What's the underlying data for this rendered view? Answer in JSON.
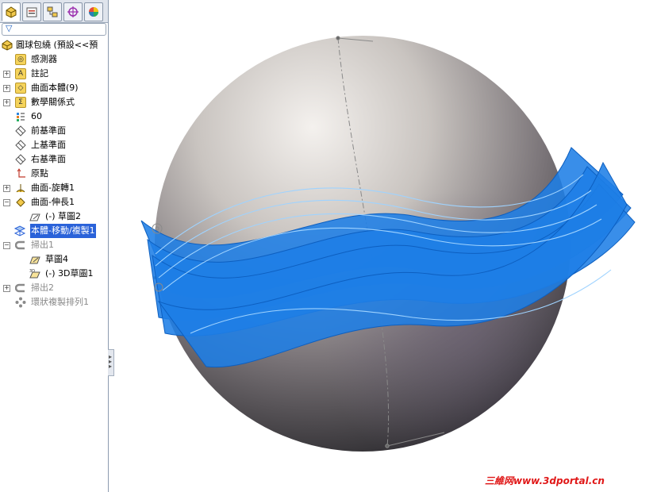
{
  "panel": {
    "tabs": [
      {
        "icon": "feature-manager-icon"
      },
      {
        "icon": "property-manager-icon"
      },
      {
        "icon": "configuration-manager-icon"
      },
      {
        "icon": "dimxpert-icon"
      },
      {
        "icon": "display-manager-icon"
      }
    ],
    "filter_icon": "filter-icon",
    "tree": [
      {
        "label": "圓球包繞 (預設<<預",
        "icon": "part-icon"
      },
      {
        "label": "感測器",
        "icon": "sensor-folder-icon"
      },
      {
        "label": "註記",
        "icon": "annotations-folder-icon"
      },
      {
        "label": "曲面本體(9)",
        "icon": "surface-bodies-folder-icon"
      },
      {
        "label": "數學關係式",
        "icon": "equations-folder-icon"
      },
      {
        "label": "60",
        "icon": "material-icon"
      },
      {
        "label": "前基準面",
        "icon": "plane-icon"
      },
      {
        "label": "上基準面",
        "icon": "plane-icon"
      },
      {
        "label": "右基準面",
        "icon": "plane-icon"
      },
      {
        "label": "原點",
        "icon": "origin-icon"
      },
      {
        "label": "曲面-旋轉1",
        "icon": "revolve-surface-icon"
      },
      {
        "label": "曲面-伸長1",
        "icon": "extrude-surface-icon"
      },
      {
        "label": "(-) 草圖2",
        "icon": "sketch-icon"
      },
      {
        "label": "本體-移動/複製1",
        "icon": "move-copy-body-icon"
      },
      {
        "label": "掃出1",
        "icon": "sweep-icon"
      },
      {
        "label": "草圖4",
        "icon": "sketch-icon"
      },
      {
        "label": "(-) 3D草圖1",
        "icon": "3d-sketch-icon"
      },
      {
        "label": "掃出2",
        "icon": "sweep-icon"
      },
      {
        "label": "環狀複製排列1",
        "icon": "circular-pattern-icon"
      }
    ]
  },
  "colors": {
    "selection": "#2a62d9",
    "surface_blue": "#1e7ee6",
    "sphere_light": "#e6e3e0",
    "sphere_dark": "#3c3a3e",
    "watermark": "#e01818"
  },
  "watermark": "三維网www.3dportal.cn"
}
